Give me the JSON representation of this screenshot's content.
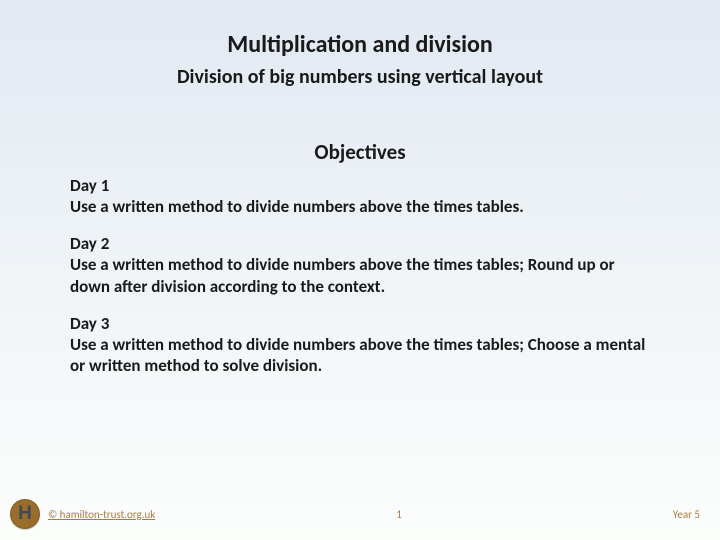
{
  "header": {
    "title": "Multiplication and division",
    "subtitle": "Division of big numbers using vertical layout"
  },
  "objectives": {
    "heading": "Objectives",
    "days": [
      {
        "label": "Day 1",
        "text": "Use a written method to divide numbers above the times tables."
      },
      {
        "label": "Day 2",
        "text": "Use a written method to divide numbers above the times tables; Round up or down after division according to the context."
      },
      {
        "label": "Day 3",
        "text": "Use a written method to divide numbers above the times tables; Choose a mental or written method to solve division."
      }
    ]
  },
  "footer": {
    "logo_letter": "H",
    "copyright": "© hamilton-trust.org.uk",
    "page_number": "1",
    "year": "Year 5"
  }
}
